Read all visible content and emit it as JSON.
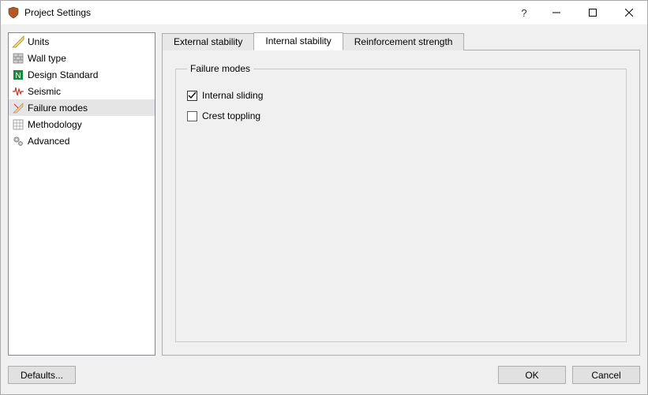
{
  "window": {
    "title": "Project Settings"
  },
  "sidebar": {
    "items": [
      {
        "label": "Units"
      },
      {
        "label": "Wall type"
      },
      {
        "label": "Design Standard"
      },
      {
        "label": "Seismic"
      },
      {
        "label": "Failure modes"
      },
      {
        "label": "Methodology"
      },
      {
        "label": "Advanced"
      }
    ],
    "selected_index": 4
  },
  "tabs": {
    "items": [
      {
        "label": "External stability"
      },
      {
        "label": "Internal stability"
      },
      {
        "label": "Reinforcement strength"
      }
    ],
    "active_index": 1
  },
  "panel": {
    "group_title": "Failure modes",
    "options": [
      {
        "label": "Internal sliding",
        "checked": true
      },
      {
        "label": "Crest toppling",
        "checked": false
      }
    ]
  },
  "footer": {
    "defaults_label": "Defaults...",
    "ok_label": "OK",
    "cancel_label": "Cancel"
  }
}
